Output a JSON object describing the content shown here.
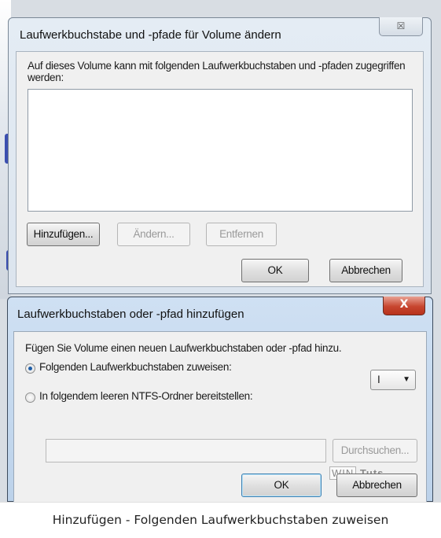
{
  "dialog1": {
    "title": "Laufwerkbuchstabe und -pfade für Volume ändern",
    "close_glyph": "☒",
    "description": "Auf dieses Volume kann mit folgenden Laufwerkbuchstaben und -pfaden zugegriffen werden:",
    "buttons": {
      "add": "Hinzufügen...",
      "change": "Ändern...",
      "remove": "Entfernen",
      "ok": "OK",
      "cancel": "Abbrechen"
    }
  },
  "dialog2": {
    "title": "Laufwerkbuchstaben oder -pfad hinzufügen",
    "close_glyph": "X",
    "description": "Fügen Sie Volume einen neuen Laufwerkbuchstaben oder -pfad hinzu.",
    "option_letter": "Folgenden Laufwerkbuchstaben zuweisen:",
    "option_folder": "In folgendem leeren NTFS-Ordner bereitstellen:",
    "drive_letter": "I",
    "browse": "Durchsuchen...",
    "ok": "OK",
    "cancel": "Abbrechen"
  },
  "watermark": {
    "part1": "WIN",
    "part2": "Tuts"
  },
  "caption": "Hinzufügen - Folgenden Laufwerkbuchstaben zuweisen",
  "colors": {
    "accent": "#3c7fb1",
    "close_active": "#c7462f"
  }
}
